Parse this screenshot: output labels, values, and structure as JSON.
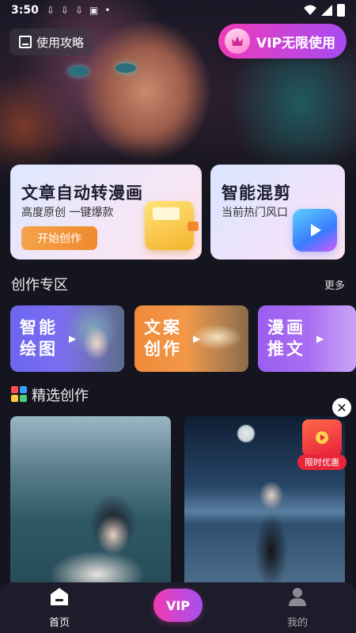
{
  "status_bar": {
    "time": "3:50"
  },
  "header": {
    "guide_label": "使用攻略",
    "vip_label": "VIP无限使用"
  },
  "feature_cards": [
    {
      "title": "文章自动转漫画",
      "subtitle": "高度原创 一键爆款",
      "button": "开始创作"
    },
    {
      "title": "智能混剪",
      "subtitle": "当前热门风口"
    }
  ],
  "creation_zone": {
    "title": "创作专区",
    "more": "更多",
    "tiles": [
      {
        "label": "智能绘图"
      },
      {
        "label": "文案创作"
      },
      {
        "label": "漫画推文"
      }
    ]
  },
  "featured": {
    "title": "精选创作",
    "promo_tag": "限时优惠",
    "icon_colors": [
      "#ff4d4d",
      "#3b9cff",
      "#ffc83d",
      "#45d17a"
    ]
  },
  "bottom_nav": {
    "home": "首页",
    "vip": "VIP",
    "mine": "我的"
  }
}
